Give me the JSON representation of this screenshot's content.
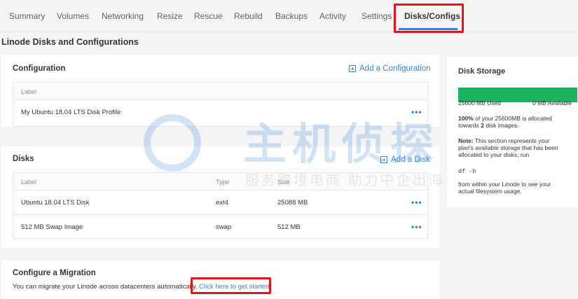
{
  "tabs": [
    {
      "label": "Summary"
    },
    {
      "label": "Volumes"
    },
    {
      "label": "Networking"
    },
    {
      "label": "Resize"
    },
    {
      "label": "Rescue"
    },
    {
      "label": "Rebuild"
    },
    {
      "label": "Backups"
    },
    {
      "label": "Activity"
    },
    {
      "label": "Settings"
    },
    {
      "label": "Disks/Configs",
      "active": true
    }
  ],
  "page_title": "Linode Disks and Configurations",
  "configuration": {
    "title": "Configuration",
    "add_label": "Add a Configuration",
    "columns": [
      "Label"
    ],
    "rows": [
      {
        "label": "My Ubuntu 18.04 LTS Disk Profile",
        "menu": "•••"
      }
    ]
  },
  "disks": {
    "title": "Disks",
    "add_label": "Add a Disk",
    "columns": [
      "Label",
      "Type",
      "Size"
    ],
    "rows": [
      {
        "label": "Ubuntu 18.04 LTS Disk",
        "type": "ext4",
        "size": "25088 MB",
        "menu": "•••"
      },
      {
        "label": "512 MB Swap Image",
        "type": "swap",
        "size": "512 MB",
        "menu": "•••"
      }
    ]
  },
  "migration": {
    "title": "Configure a Migration",
    "text": "You can migrate your Linode across datacenters automatically.",
    "link": "Click here to get started."
  },
  "storage": {
    "title": "Disk Storage",
    "used_fraction": 1.0,
    "used_label": "25600 MB Used",
    "available_label": "0 MB Available",
    "allocated_pct": "100%",
    "allocated_text_1": "of your 25600MB is allocated",
    "allocated_text_2": "towards",
    "allocated_count": "2",
    "allocated_text_3": "disk images.",
    "note_label": "Note:",
    "note_line_1": "This section represents your",
    "note_line_2": "plan's available storage that has been",
    "note_line_3": "allocated to your disks; run",
    "command": "df -h",
    "after_line_1": "from within your Linode to see your",
    "after_line_2": "actual filesystem usage."
  },
  "watermark": {
    "big": "主机侦探",
    "small": "服务跨境电商 助力中企出海"
  },
  "colors": {
    "accent": "#3683dc",
    "bar_fill": "#1ab35a",
    "highlight": "#e4141b"
  }
}
